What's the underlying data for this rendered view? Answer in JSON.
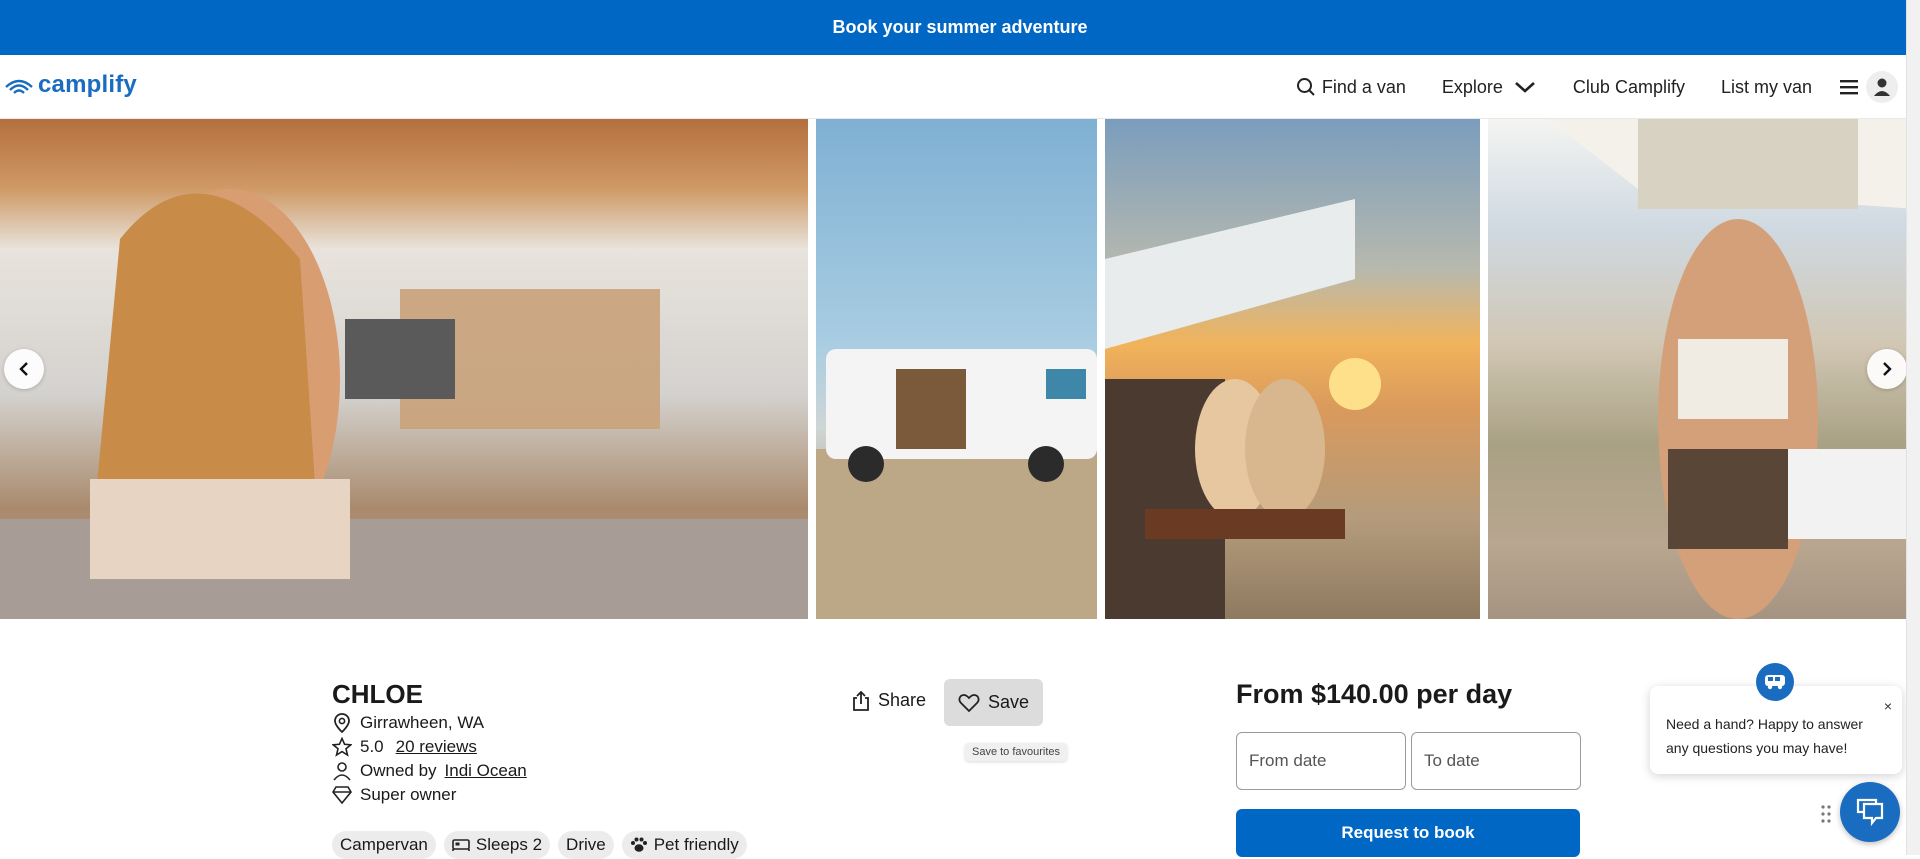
{
  "banner": {
    "text": "Book your summer adventure"
  },
  "logo": {
    "text": "camplify"
  },
  "nav": {
    "find_van": "Find a van",
    "explore": "Explore",
    "club": "Club Camplify",
    "list_van": "List my van"
  },
  "listing": {
    "title": "CHLOE",
    "location": "Girrawheen, WA",
    "rating": "5.0",
    "reviews": "20 reviews",
    "owned_by_prefix": "Owned by",
    "owner": "Indi Ocean",
    "badge": "Super owner",
    "share": "Share",
    "save": "Save",
    "save_tooltip": "Save to favourites",
    "tags": [
      "Campervan",
      "Sleeps 2",
      "Drive",
      "Pet friendly"
    ]
  },
  "booking": {
    "price": "From $140.00 per day",
    "from_date": "From date",
    "to_date": "To date",
    "request": "Request to book"
  },
  "chat": {
    "message": "Need a hand? Happy to answer any questions you may have!",
    "close": "×"
  },
  "colors": {
    "brand_blue": "#0067c5",
    "logo_blue": "#1a6cc0"
  }
}
